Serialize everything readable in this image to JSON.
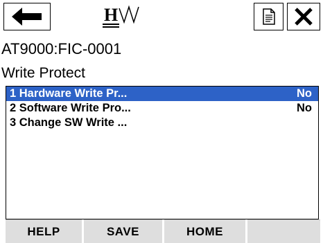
{
  "header": {
    "back_icon": "left-arrow-icon",
    "doc_icon": "document-icon",
    "close_icon": "close-x-icon",
    "logo_letter": "H"
  },
  "device_tag": "AT9000:FIC-0001",
  "page_title": "Write Protect",
  "menu": {
    "items": [
      {
        "label": "1 Hardware Write Pr...",
        "value": "No",
        "selected": true
      },
      {
        "label": "2 Software Write Pro...",
        "value": "No",
        "selected": false
      },
      {
        "label": "3 Change SW Write ...",
        "value": "",
        "selected": false
      }
    ]
  },
  "softkeys": {
    "f1": "HELP",
    "f2": "SAVE",
    "f3": "HOME",
    "f4": ""
  },
  "colors": {
    "selection": "#2d62c7",
    "softkey_bg": "#dedede"
  }
}
